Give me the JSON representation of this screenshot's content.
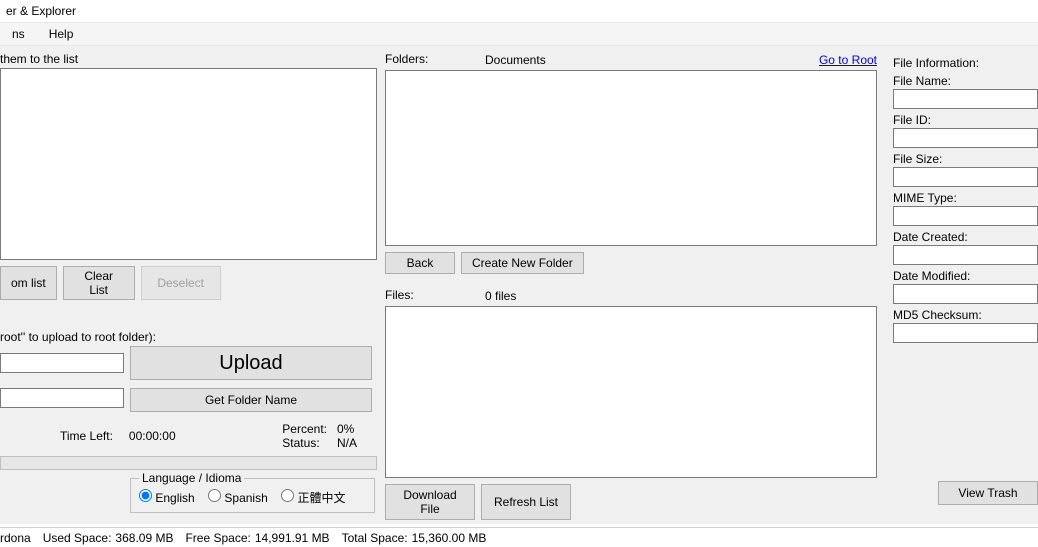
{
  "title": "er & Explorer",
  "menu": {
    "item1": "ns",
    "item2": "Help"
  },
  "left": {
    "hint": "them to the list",
    "remove": "om list",
    "clear": "Clear List",
    "deselect": "Deselect",
    "root_hint": "root'' to upload to root folder):",
    "upload": "Upload",
    "getfolder": "Get Folder Name",
    "timeleft_label": "Time Left:",
    "timeleft_val": "00:00:00",
    "percent_label": "Percent:",
    "percent_val": "0%",
    "status_label": "Status:",
    "status_val": "N/A",
    "lang_legend": "Language / Idioma",
    "lang_en": "English",
    "lang_es": "Spanish",
    "lang_zh": "正體中文"
  },
  "mid": {
    "folders_label": "Folders:",
    "folders_current": "Documents",
    "goto_root": "Go to Root",
    "back": "Back",
    "createfolder": "Create New Folder",
    "files_label": "Files:",
    "files_count": "0 files",
    "download": "Download File",
    "refresh": "Refresh List"
  },
  "right": {
    "heading": "File Information:",
    "filename": "File Name:",
    "fileid": "File ID:",
    "filesize": "File Size:",
    "mime": "MIME Type:",
    "created": "Date Created:",
    "modified": "Date Modified:",
    "md5": "MD5 Checksum:",
    "viewtrash": "View Trash"
  },
  "status": {
    "user": "rdona",
    "used_label": "Used Space:",
    "used_val": "368.09 MB",
    "free_label": "Free Space:",
    "free_val": "14,991.91 MB",
    "total_label": "Total Space:",
    "total_val": "15,360.00 MB"
  }
}
